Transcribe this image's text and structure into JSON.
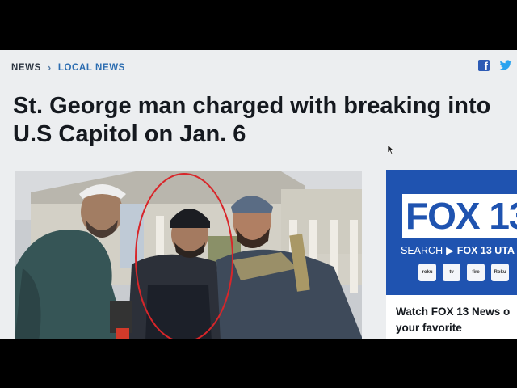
{
  "breadcrumb": {
    "news": "NEWS",
    "local_news": "LOCAL NEWS"
  },
  "share": {
    "facebook_icon": "facebook-icon",
    "twitter_icon": "twitter-icon"
  },
  "article": {
    "headline": "St. George man charged with breaking into\nU.S Capitol on Jan. 6"
  },
  "ad": {
    "logo": "FOX 13",
    "search_label": "SEARCH",
    "search_target": "FOX 13 UTA",
    "apps": [
      "roku",
      "tv",
      "fire",
      "Roku"
    ],
    "promo": "Watch FOX 13 News o\nyour favorite"
  },
  "colors": {
    "brand_blue": "#1f53b0",
    "link_blue": "#2b6cb0",
    "headline": "#15191f"
  }
}
